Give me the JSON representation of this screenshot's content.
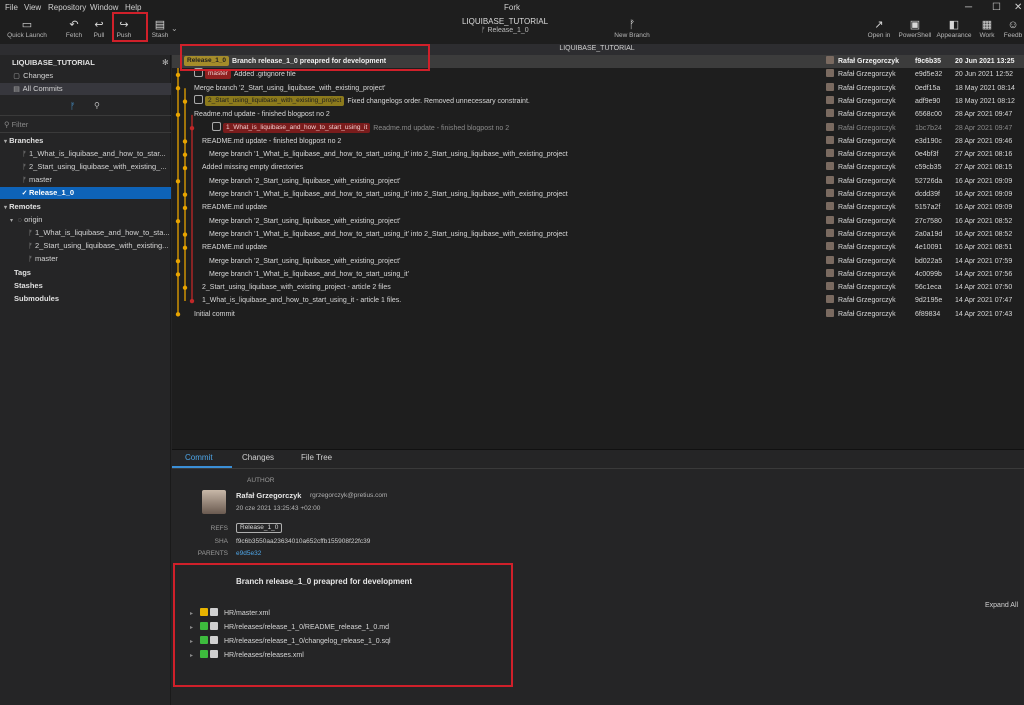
{
  "menu": {
    "items": [
      "File",
      "View",
      "Repository",
      "Window",
      "Help"
    ],
    "app_title": "Fork",
    "win_minimize": "─",
    "win_maximize": "☐",
    "win_close": "✕"
  },
  "toolbar": {
    "quick_launch": "Quick Launch",
    "fetch": "Fetch",
    "pull": "Pull",
    "push": "Push",
    "stash": "Stash",
    "repo_title": "LIQUIBASE_TUTORIAL",
    "repo_branch": "Release_1_0",
    "new_branch": "New Branch",
    "open_in": "Open in",
    "powershell": "PowerShell",
    "appearance": "Appearance",
    "work": "Work",
    "feedback": "Feedb"
  },
  "tabstrip": {
    "title": "LIQUIBASE_TUTORIAL"
  },
  "sidebar": {
    "repo_name": "LIQUIBASE_TUTORIAL",
    "changes": "Changes",
    "all_commits": "All Commits",
    "filter_placeholder": "Filter",
    "branches_header": "Branches",
    "branches": [
      "1_What_is_liquibase_and_how_to_star...",
      "2_Start_using_liquibase_with_existing_...",
      "master",
      "Release_1_0"
    ],
    "remotes_header": "Remotes",
    "remote_origin": "origin",
    "remote_branches": [
      "1_What_is_liquibase_and_how_to_sta...",
      "2_Start_using_liquibase_with_existing...",
      "master"
    ],
    "tags_header": "Tags",
    "stashes_header": "Stashes",
    "submodules_header": "Submodules"
  },
  "commits": [
    {
      "badge": "Release_1_0",
      "badge_type": "release",
      "message": "Branch release_1_0 preapred for development",
      "author": "Rafał Grzegorczyk",
      "sha": "f9c6b35",
      "date": "20 Jun 2021 13:25"
    },
    {
      "badge": "master",
      "badge_type": "master",
      "message": "Added .gitignore file",
      "author": "Rafał Grzegorczyk",
      "sha": "e9d5e32",
      "date": "20 Jun 2021 12:52"
    },
    {
      "badge": "",
      "badge_type": "",
      "message": "Merge branch '2_Start_using_liquibase_with_existing_project'",
      "author": "Rafał Grzegorczyk",
      "sha": "0edf15a",
      "date": "18 May 2021 08:14"
    },
    {
      "badge": "2_Start_using_liquibase_with_existing_project",
      "badge_type": "b2",
      "message": "Fixed changelogs order. Removed unnecessary constraint.",
      "author": "Rafał Grzegorczyk",
      "sha": "adf9e90",
      "date": "18 May 2021 08:12"
    },
    {
      "badge": "",
      "badge_type": "",
      "message": "Readme.md update - finished blogpost no 2",
      "author": "Rafał Grzegorczyk",
      "sha": "6568c00",
      "date": "28 Apr 2021 09:47"
    },
    {
      "badge": "1_What_is_liquibase_and_how_to_start_using_it",
      "badge_type": "b1",
      "message": "Readme.md update - finished blogpost no 2",
      "author": "Rafał Grzegorczyk",
      "sha": "1bc7b24",
      "date": "28 Apr 2021 09:47",
      "dim": true
    },
    {
      "badge": "",
      "badge_type": "",
      "message": "README.md update - finished blogpost no 2",
      "author": "Rafał Grzegorczyk",
      "sha": "e3d190c",
      "date": "28 Apr 2021 09:46"
    },
    {
      "badge": "",
      "badge_type": "",
      "message": "Merge branch '1_What_is_liquibase_and_how_to_start_using_it' into 2_Start_using_liquibase_with_existing_project",
      "author": "Rafał Grzegorczyk",
      "sha": "0e4bf3f",
      "date": "27 Apr 2021 08:16"
    },
    {
      "badge": "",
      "badge_type": "",
      "message": "Added missing empty directories",
      "author": "Rafał Grzegorczyk",
      "sha": "c59cb35",
      "date": "27 Apr 2021 08:15"
    },
    {
      "badge": "",
      "badge_type": "",
      "message": "Merge branch '2_Start_using_liquibase_with_existing_project'",
      "author": "Rafał Grzegorczyk",
      "sha": "52726da",
      "date": "16 Apr 2021 09:09"
    },
    {
      "badge": "",
      "badge_type": "",
      "message": "Merge branch '1_What_is_liquibase_and_how_to_start_using_it' into 2_Start_using_liquibase_with_existing_project",
      "author": "Rafał Grzegorczyk",
      "sha": "dcdd39f",
      "date": "16 Apr 2021 09:09"
    },
    {
      "badge": "",
      "badge_type": "",
      "message": "README.md update",
      "author": "Rafał Grzegorczyk",
      "sha": "5157a2f",
      "date": "16 Apr 2021 09:09"
    },
    {
      "badge": "",
      "badge_type": "",
      "message": "Merge branch '2_Start_using_liquibase_with_existing_project'",
      "author": "Rafał Grzegorczyk",
      "sha": "27c7580",
      "date": "16 Apr 2021 08:52"
    },
    {
      "badge": "",
      "badge_type": "",
      "message": "Merge branch '1_What_is_liquibase_and_how_to_start_using_it' into 2_Start_using_liquibase_with_existing_project",
      "author": "Rafał Grzegorczyk",
      "sha": "2a0a19d",
      "date": "16 Apr 2021 08:52"
    },
    {
      "badge": "",
      "badge_type": "",
      "message": "README.md update",
      "author": "Rafał Grzegorczyk",
      "sha": "4e10091",
      "date": "16 Apr 2021 08:51"
    },
    {
      "badge": "",
      "badge_type": "",
      "message": "Merge branch '2_Start_using_liquibase_with_existing_project'",
      "author": "Rafał Grzegorczyk",
      "sha": "bd022a5",
      "date": "14 Apr 2021 07:59"
    },
    {
      "badge": "",
      "badge_type": "",
      "message": "Merge branch '1_What_is_liquibase_and_how_to_start_using_it'",
      "author": "Rafał Grzegorczyk",
      "sha": "4c0099b",
      "date": "14 Apr 2021 07:56"
    },
    {
      "badge": "",
      "badge_type": "",
      "message": "2_Start_using_liquibase_with_existing_project - article 2 files",
      "author": "Rafał Grzegorczyk",
      "sha": "56c1eca",
      "date": "14 Apr 2021 07:50"
    },
    {
      "badge": "",
      "badge_type": "",
      "message": "1_What_is_liquibase_and_how_to_start_using_it - article 1 files.",
      "author": "Rafał Grzegorczyk",
      "sha": "9d2195e",
      "date": "14 Apr 2021 07:47"
    },
    {
      "badge": "",
      "badge_type": "",
      "message": "Initial commit",
      "author": "Rafał Grzegorczyk",
      "sha": "6f89834",
      "date": "14 Apr 2021 07:43"
    }
  ],
  "details": {
    "tabs": [
      "Commit",
      "Changes",
      "File Tree"
    ],
    "author_label": "AUTHOR",
    "author_name": "Rafał Grzegorczyk",
    "author_email": "rgrzegorczyk@pretius.com",
    "author_date": "20 cze 2021 13:25:43 +02:00",
    "refs_label": "REFS",
    "refs_value": "Release_1_0",
    "sha_label": "SHA",
    "sha_value": "f9c6b3550aa23634010a652cffb155908f22fc39",
    "parents_label": "PARENTS",
    "parents_value": "e9d5e32",
    "subject": "Branch release_1_0 preapred for development",
    "expand_all": "Expand All",
    "files": [
      {
        "path": "HR/master.xml",
        "status": "modified"
      },
      {
        "path": "HR/releases/release_1_0/README_release_1_0.md",
        "status": "added"
      },
      {
        "path": "HR/releases/release_1_0/changelog_release_1_0.sql",
        "status": "added"
      },
      {
        "path": "HR/releases/releases.xml",
        "status": "added"
      }
    ]
  },
  "colors": {
    "accent": "#0e63b8",
    "graph_main": "#e8a400",
    "graph_branch": "#c02828",
    "highlight": "#d0202a",
    "status_modified": "#e8b400",
    "status_added": "#3dbb3d"
  }
}
